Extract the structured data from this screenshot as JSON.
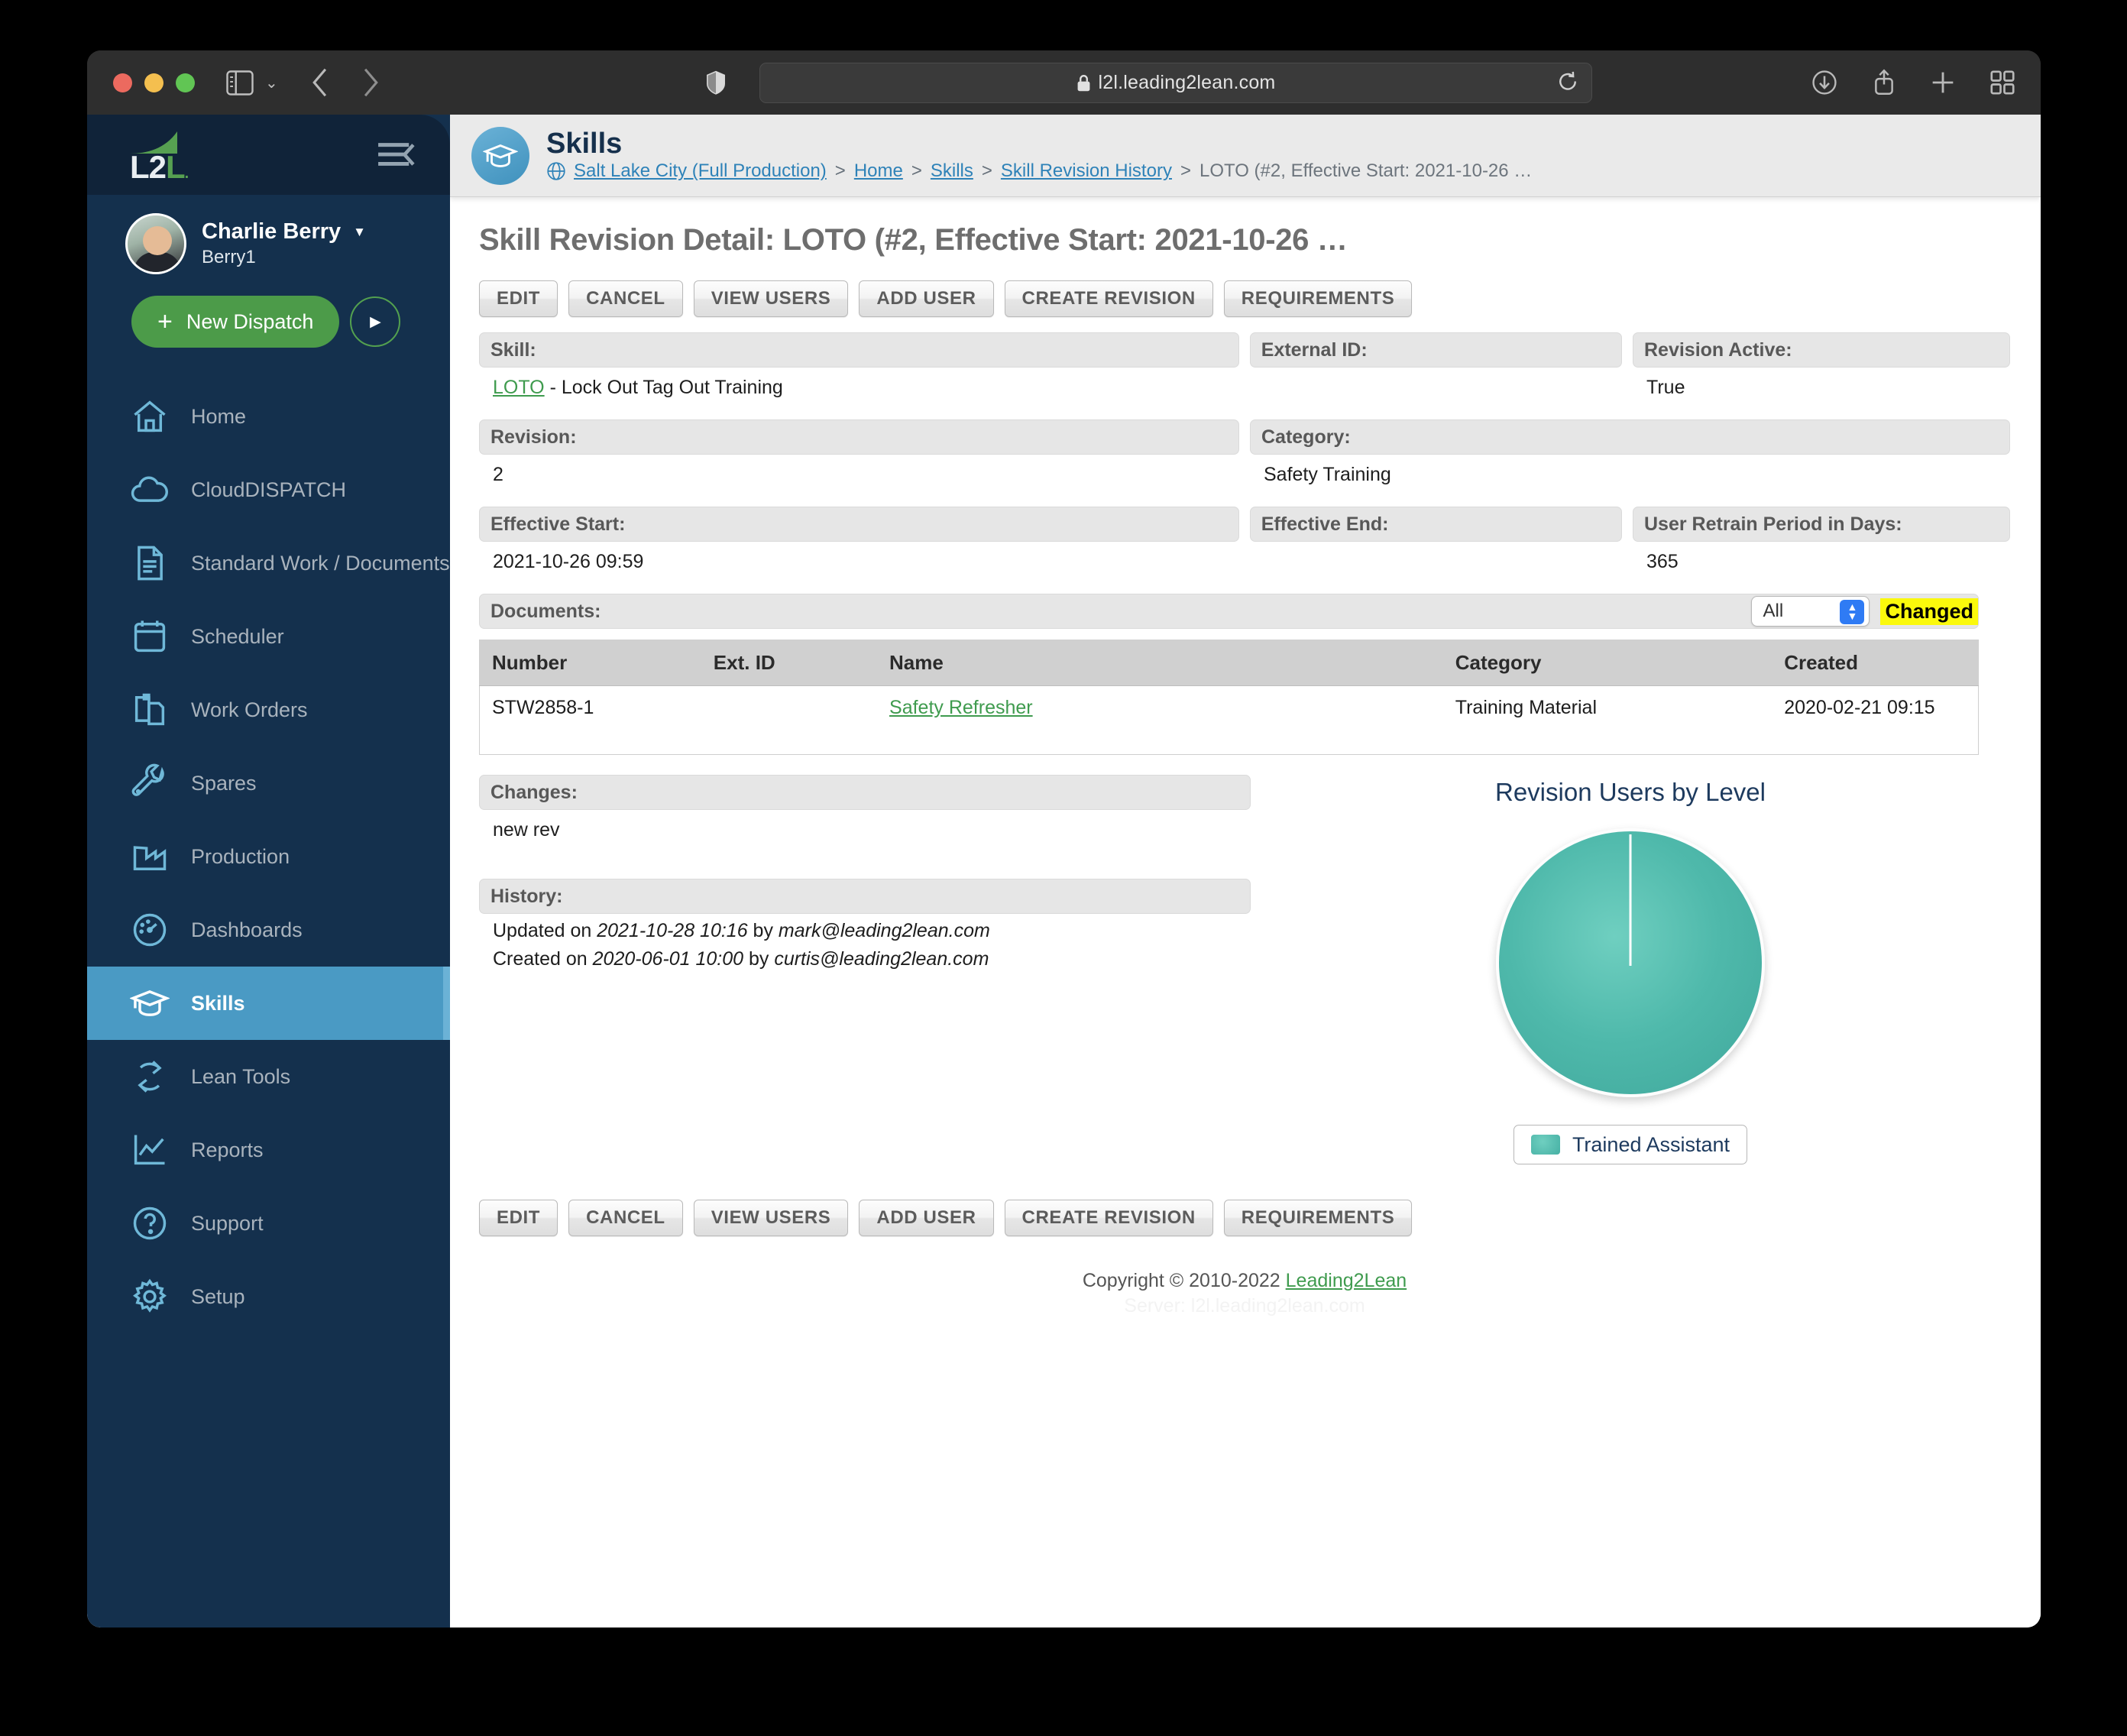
{
  "browser": {
    "url": "l2l.leading2lean.com",
    "icons": {
      "sidebar_toggle": "sidebar-toggle-icon",
      "back": "back-chevron-icon",
      "forward": "forward-chevron-icon",
      "shield": "privacy-shield-icon",
      "lock": "lock-icon",
      "reload": "reload-icon",
      "downloads": "downloads-icon",
      "share": "share-icon",
      "new_tab": "plus-icon",
      "tab_overview": "tab-overview-icon"
    }
  },
  "sidebar": {
    "logo_text_left": "L2",
    "logo_text_right": "L",
    "user": {
      "name": "Charlie Berry",
      "login": "Berry1"
    },
    "new_dispatch_label": "New Dispatch",
    "items": [
      {
        "label": "Home",
        "icon": "home-icon",
        "active": false
      },
      {
        "label": "CloudDISPATCH",
        "icon": "cloud-icon",
        "active": false
      },
      {
        "label": "Standard Work / Documents",
        "icon": "document-icon",
        "active": false
      },
      {
        "label": "Scheduler",
        "icon": "calendar-icon",
        "active": false
      },
      {
        "label": "Work Orders",
        "icon": "clipboard-icon",
        "active": false
      },
      {
        "label": "Spares",
        "icon": "wrench-icon",
        "active": false
      },
      {
        "label": "Production",
        "icon": "factory-icon",
        "active": false
      },
      {
        "label": "Dashboards",
        "icon": "gauge-icon",
        "active": false
      },
      {
        "label": "Skills",
        "icon": "graduation-cap-icon",
        "active": true
      },
      {
        "label": "Lean Tools",
        "icon": "recycle-icon",
        "active": false
      },
      {
        "label": "Reports",
        "icon": "line-chart-icon",
        "active": false
      },
      {
        "label": "Support",
        "icon": "question-circle-icon",
        "active": false
      },
      {
        "label": "Setup",
        "icon": "gear-icon",
        "active": false
      }
    ]
  },
  "header": {
    "title": "Skills",
    "breadcrumb": {
      "site": "Salt Lake City (Full Production)",
      "links": [
        "Home",
        "Skills",
        "Skill Revision History"
      ],
      "current": "LOTO (#2, Effective Start: 2021-10-26 …"
    }
  },
  "page": {
    "title": "Skill Revision Detail: LOTO (#2, Effective Start: 2021-10-26 …",
    "buttons": [
      "EDIT",
      "CANCEL",
      "VIEW USERS",
      "ADD USER",
      "CREATE REVISION",
      "REQUIREMENTS"
    ],
    "fields": {
      "skill_label": "Skill:",
      "skill_link": "LOTO",
      "skill_rest": " - Lock Out Tag Out Training",
      "external_id_label": "External ID:",
      "external_id_value": "",
      "revision_active_label": "Revision Active:",
      "revision_active_value": "True",
      "revision_label": "Revision:",
      "revision_value": "2",
      "category_label": "Category:",
      "category_value": "Safety Training",
      "effective_start_label": "Effective Start:",
      "effective_start_value": "2021-10-26 09:59",
      "effective_end_label": "Effective End:",
      "effective_end_value": "",
      "retrain_label": "User Retrain Period in Days:",
      "retrain_value": "365"
    },
    "documents": {
      "label": "Documents:",
      "filter_value": "All",
      "changed_badge": "Changed",
      "columns": [
        "Number",
        "Ext. ID",
        "Name",
        "Category",
        "Created"
      ],
      "rows": [
        {
          "number": "STW2858-1",
          "ext_id": "",
          "name": "Safety Refresher",
          "category": "Training Material",
          "created": "2020-02-21 09:15"
        }
      ]
    },
    "changes": {
      "label": "Changes:",
      "value": "new rev"
    },
    "history": {
      "label": "History:",
      "lines": [
        {
          "prefix": "Updated on ",
          "date": "2021-10-28 10:16",
          "mid": " by ",
          "user": "mark@leading2lean.com"
        },
        {
          "prefix": "Created on ",
          "date": "2020-06-01 10:00",
          "mid": " by ",
          "user": "curtis@leading2lean.com"
        }
      ]
    },
    "footer": {
      "copyright_prefix": "Copyright © 2010-2022 ",
      "copyright_link": "Leading2Lean",
      "server": "Server: l2l.leading2lean.com"
    }
  },
  "chart_data": {
    "type": "pie",
    "title": "Revision Users by Level",
    "categories": [
      "Trained Assistant"
    ],
    "values": [
      100
    ],
    "value_unit": "%",
    "colors": [
      "#4fb9ab"
    ],
    "legend": [
      "Trained Assistant"
    ],
    "legend_position": "bottom"
  }
}
